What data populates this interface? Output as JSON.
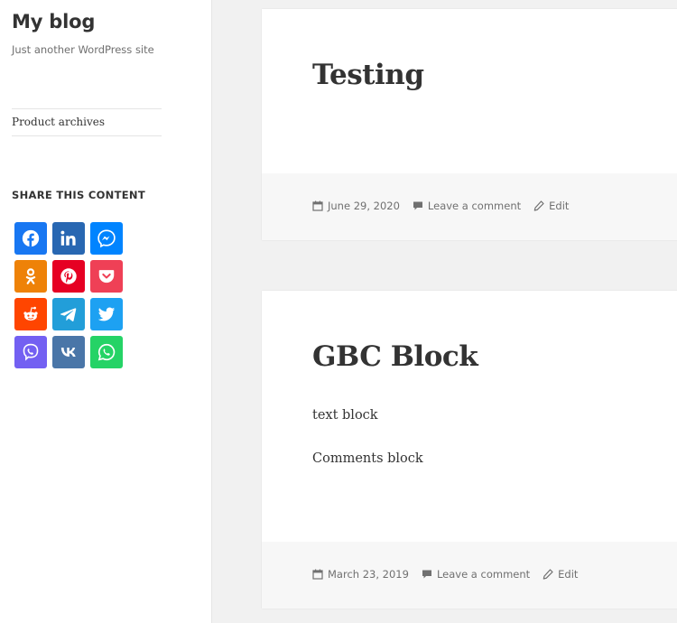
{
  "site": {
    "title": "My blog",
    "description": "Just another WordPress site"
  },
  "widgets": {
    "links": [
      "Product archives"
    ],
    "share_title": "SHARE THIS CONTENT"
  },
  "share_buttons": [
    {
      "name": "facebook",
      "color": "#1877f2",
      "icon": "facebook-icon"
    },
    {
      "name": "linkedin",
      "color": "#2867b2",
      "icon": "linkedin-icon"
    },
    {
      "name": "messenger",
      "color": "#0084ff",
      "icon": "messenger-icon"
    },
    {
      "name": "odnoklassniki",
      "color": "#ee8208",
      "icon": "odnoklassniki-icon"
    },
    {
      "name": "pinterest",
      "color": "#e60023",
      "icon": "pinterest-icon"
    },
    {
      "name": "pocket",
      "color": "#ef4056",
      "icon": "pocket-icon"
    },
    {
      "name": "reddit",
      "color": "#ff4500",
      "icon": "reddit-icon"
    },
    {
      "name": "telegram",
      "color": "#229ed9",
      "icon": "telegram-icon"
    },
    {
      "name": "twitter",
      "color": "#1da1f2",
      "icon": "twitter-icon"
    },
    {
      "name": "viber",
      "color": "#7360f2",
      "icon": "viber-icon"
    },
    {
      "name": "vk",
      "color": "#4a76a8",
      "icon": "vk-icon"
    },
    {
      "name": "whatsapp",
      "color": "#25d366",
      "icon": "whatsapp-icon"
    }
  ],
  "posts": [
    {
      "title": "Testing",
      "paragraphs": [],
      "date": "June 29, 2020",
      "comment_link": "Leave a comment",
      "edit_link": "Edit"
    },
    {
      "title": "GBC Block",
      "paragraphs": [
        "text block",
        "Comments block"
      ],
      "date": "March 23, 2019",
      "comment_link": "Leave a comment",
      "edit_link": "Edit"
    }
  ]
}
